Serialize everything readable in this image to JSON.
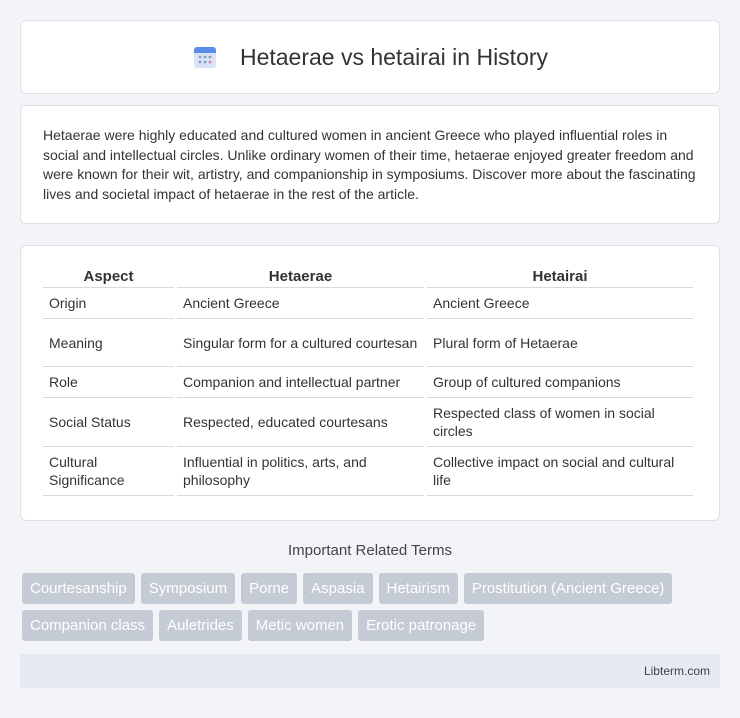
{
  "header": {
    "title": "Hetaerae vs hetairai in History",
    "icon": "calendar-icon"
  },
  "intro": {
    "text": "Hetaerae were highly educated and cultured women in ancient Greece who played influential roles in social and intellectual circles. Unlike ordinary women of their time, hetaerae enjoyed greater freedom and were known for their wit, artistry, and companionship in symposiums. Discover more about the fascinating lives and societal impact of hetaerae in the rest of the article."
  },
  "table": {
    "headers": [
      "Aspect",
      "Hetaerae",
      "Hetairai"
    ],
    "rows": [
      [
        "Origin",
        "Ancient Greece",
        "Ancient Greece"
      ],
      [
        "Meaning",
        "Singular form for a cultured courtesan",
        "Plural form of Hetaerae"
      ],
      [
        "Role",
        "Companion and intellectual partner",
        "Group of cultured companions"
      ],
      [
        "Social Status",
        "Respected, educated courtesans",
        "Respected class of women in social circles"
      ],
      [
        "Cultural Significance",
        "Influential in politics, arts, and philosophy",
        "Collective impact on social and cultural life"
      ]
    ]
  },
  "related": {
    "title": "Important Related Terms",
    "tags_row1": [
      "Courtesanship",
      "Symposium",
      "Porne",
      "Aspasia",
      "Hetairism",
      "Prostitution (Ancient Greece)"
    ],
    "tags_row2": [
      "Companion class",
      "Auletrides",
      "Metic women",
      "Erotic patronage"
    ]
  },
  "footer": {
    "text": "Libterm.com"
  },
  "colors": {
    "tag_bg": "#c4cbd4",
    "footer_bg": "#e4e9f2",
    "page_bg": "#f2f4f7"
  }
}
